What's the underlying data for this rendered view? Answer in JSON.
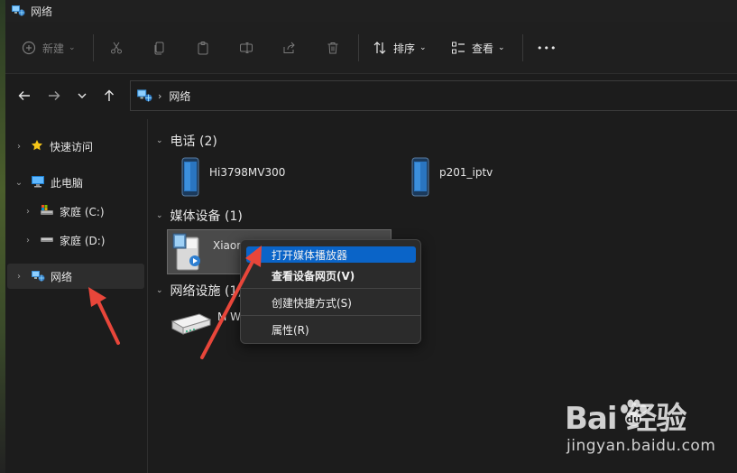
{
  "window": {
    "title": "网络"
  },
  "toolbar": {
    "new_label": "新建",
    "sort_label": "排序",
    "view_label": "查看",
    "more_label": "•••"
  },
  "address": {
    "crumb": "网络"
  },
  "sidebar": {
    "items": [
      {
        "label": "快速访问"
      },
      {
        "label": "此电脑"
      },
      {
        "label": "家庭 (C:)"
      },
      {
        "label": "家庭 (D:)"
      },
      {
        "label": "网络"
      }
    ]
  },
  "groups": [
    {
      "header": "电话 (2)",
      "items": [
        {
          "label": "Hi3798MV300"
        },
        {
          "label": "p201_iptv"
        }
      ]
    },
    {
      "header": "媒体设备 (1)",
      "items": [
        {
          "label": "Xiaom"
        }
      ]
    },
    {
      "header": "网络设施 (1)",
      "items": [
        {
          "label": "M Wi"
        }
      ]
    }
  ],
  "context_menu": {
    "items": [
      {
        "label": "打开媒体播放器"
      },
      {
        "label": "查看设备网页(V)"
      },
      {
        "label": "创建快捷方式(S)"
      },
      {
        "label": "属性(R)"
      }
    ]
  },
  "watermark": {
    "brand": "Bai  经验",
    "url": "jingyan.baidu.com"
  },
  "colors": {
    "accent": "#0a64c8",
    "annotation_arrow": "#e8463a",
    "background": "#1c1c1c"
  }
}
